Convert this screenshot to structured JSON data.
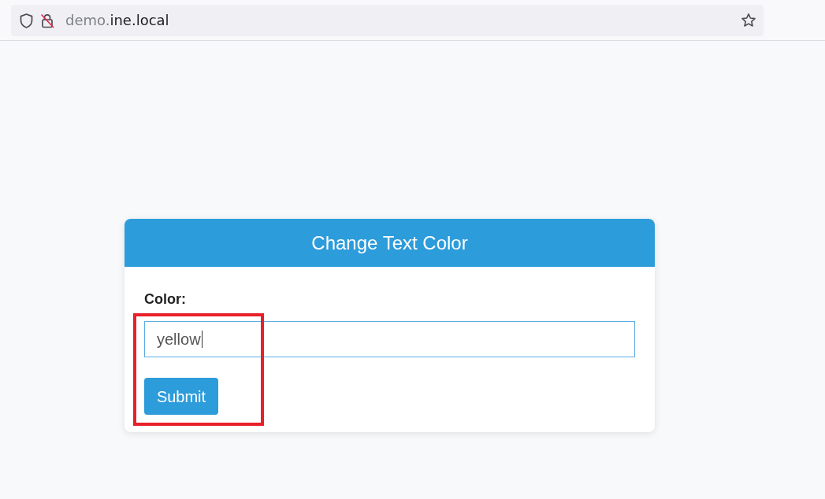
{
  "address_bar": {
    "url": {
      "subdomain": "demo.",
      "domain": "ine.local"
    }
  },
  "card": {
    "title": "Change Text Color",
    "field": {
      "label": "Color:",
      "value": "yellow",
      "focused": true
    },
    "button": {
      "label": "Submit"
    }
  },
  "annotation": {
    "kind": "rectangle"
  }
}
